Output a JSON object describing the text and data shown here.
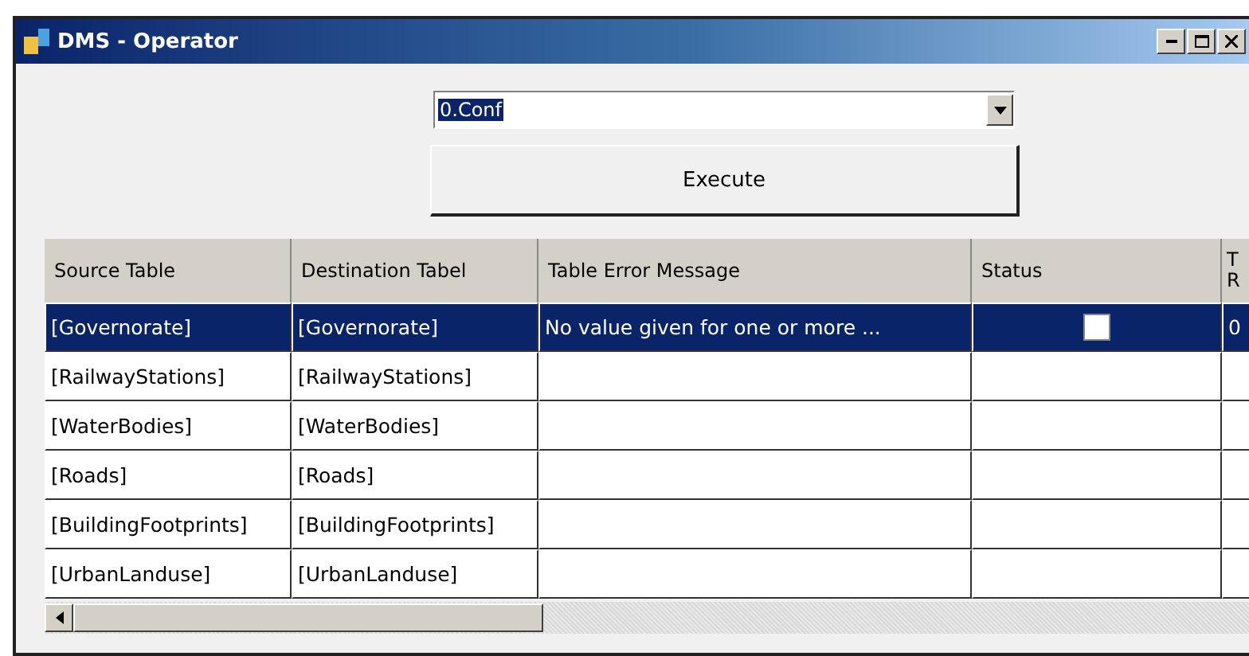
{
  "window": {
    "title": "DMS - Operator"
  },
  "config_select": {
    "value": "0.Conf"
  },
  "execute_button": {
    "label": "Execute"
  },
  "table": {
    "columns": [
      "Source Table",
      "Destination Tabel",
      "Table Error Message",
      "Status",
      "T R"
    ],
    "rows": [
      {
        "source": "[Governorate]",
        "destination": "[Governorate]",
        "error": "No value given for one or more ...",
        "status_checkbox": {
          "checked": false
        },
        "column_5": "0",
        "selected": true
      },
      {
        "source": "[RailwayStations]",
        "destination": "[RailwayStations]",
        "selected": false
      },
      {
        "source": "[WaterBodies]",
        "destination": "[WaterBodies]",
        "selected": false
      },
      {
        "source": "[Roads]",
        "destination": "[Roads]",
        "selected": false
      },
      {
        "source": "[BuildingFootprints]",
        "destination": "[BuildingFootprints]",
        "selected": false
      },
      {
        "source": "[UrbanLanduse]",
        "destination": "[UrbanLanduse]",
        "selected": false
      }
    ]
  }
}
